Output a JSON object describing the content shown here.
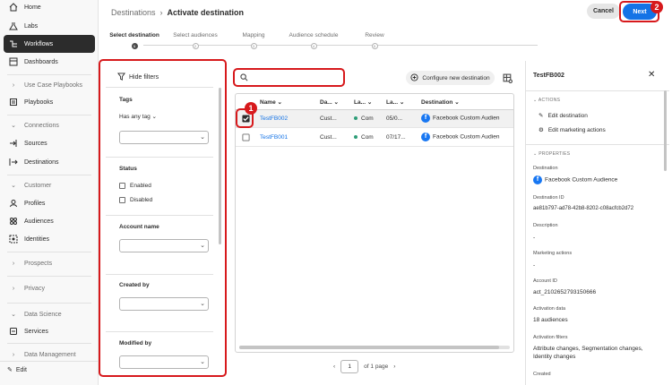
{
  "nav": {
    "items": [
      {
        "label": "Home",
        "icon": "home-icon"
      },
      {
        "label": "Labs",
        "icon": "flask-icon"
      },
      {
        "label": "Workflows",
        "icon": "workflow-icon"
      },
      {
        "label": "Dashboards",
        "icon": "dashboard-icon"
      },
      {
        "label": "Use Case Playbooks",
        "icon": "chevron-right-icon"
      },
      {
        "label": "Playbooks",
        "icon": "book-icon"
      },
      {
        "label": "Connections",
        "icon": "chevron-down-icon"
      },
      {
        "label": "Sources",
        "icon": "source-icon"
      },
      {
        "label": "Destinations",
        "icon": "destination-icon"
      },
      {
        "label": "Customer",
        "icon": "chevron-down-icon"
      },
      {
        "label": "Profiles",
        "icon": "profile-icon"
      },
      {
        "label": "Audiences",
        "icon": "audiences-icon"
      },
      {
        "label": "Identities",
        "icon": "identities-icon"
      },
      {
        "label": "Prospects",
        "icon": "chevron-right-icon"
      },
      {
        "label": "Privacy",
        "icon": "chevron-right-icon"
      },
      {
        "label": "Data Science",
        "icon": "chevron-down-icon"
      },
      {
        "label": "Services",
        "icon": "services-icon"
      },
      {
        "label": "Data Management",
        "icon": "chevron-right-icon"
      }
    ],
    "edit_label": "Edit"
  },
  "header": {
    "breadcrumb_root": "Destinations",
    "breadcrumb_sep": "›",
    "breadcrumb_current": "Activate destination",
    "cancel_label": "Cancel",
    "next_label": "Next"
  },
  "steps": [
    {
      "label": "Select destination",
      "num": "1"
    },
    {
      "label": "Select audiences",
      "num": "2"
    },
    {
      "label": "Mapping",
      "num": "3"
    },
    {
      "label": "Audience schedule",
      "num": "4"
    },
    {
      "label": "Review",
      "num": "5"
    }
  ],
  "filters": {
    "hide_label": "Hide filters",
    "tags_label": "Tags",
    "tags_mode": "Has any tag",
    "status_label": "Status",
    "enabled_label": "Enabled",
    "disabled_label": "Disabled",
    "account_label": "Account name",
    "created_label": "Created by",
    "modified_label": "Modified by"
  },
  "toolbar": {
    "search_placeholder": "",
    "configure_label": "Configure new destination"
  },
  "table": {
    "columns": [
      "Name",
      "Da...",
      "La...",
      "La...",
      "Destination"
    ],
    "rows": [
      {
        "name": "TestFB002",
        "col2": "Cust...",
        "col3": "Com",
        "col4": "05/0...",
        "destination": "Facebook Custom Audien",
        "checked": true
      },
      {
        "name": "TestFB001",
        "col2": "Cust...",
        "col3": "Com",
        "col4": "07/17...",
        "destination": "Facebook Custom Audien",
        "checked": false
      }
    ]
  },
  "pager": {
    "page": "1",
    "of_label": "of 1 page"
  },
  "annotations": {
    "badge1": "1",
    "badge2": "2"
  },
  "detail": {
    "title": "TestFB002",
    "actions_head": "ACTIONS",
    "edit_destination": "Edit destination",
    "edit_marketing": "Edit marketing actions",
    "properties_head": "PROPERTIES",
    "destination_label": "Destination",
    "destination_value": "Facebook Custom Audience",
    "destination_id_label": "Destination ID",
    "destination_id_value": "ae81b797-ad78-42b8-8202-c08acfcb2d72",
    "description_label": "Description",
    "description_value": "-",
    "marketing_label": "Marketing actions",
    "marketing_value": "-",
    "account_label": "Account ID",
    "account_value": "act_2102652793150666",
    "activation_label": "Activation data",
    "activation_value": "18 audiences",
    "filters_label": "Activation filters",
    "filters_value": "Attribute changes, Segmentation changes, Identity changes",
    "created_label": "Created"
  },
  "colors": {
    "accent": "#1473e6",
    "highlight": "#d7191c",
    "facebook": "#1877f2"
  }
}
